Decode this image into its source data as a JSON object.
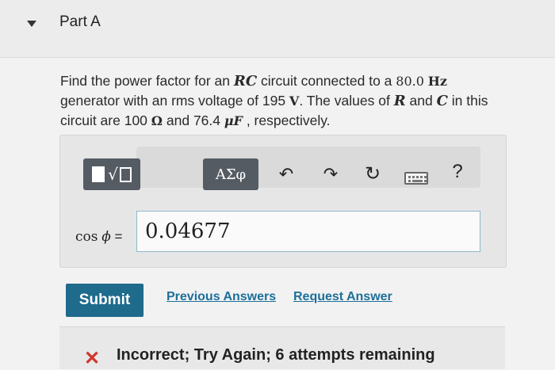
{
  "part": {
    "title": "Part A"
  },
  "question": {
    "text1": "Find the power factor for an ",
    "rc": "RC",
    "text2": " circuit connected to a ",
    "freq_value": "80.0",
    "freq_unit": "Hz",
    "text3": "generator with an rms voltage of 195 ",
    "volt_unit": "V",
    "text4": ". The values of ",
    "r": "R",
    "text5": " and ",
    "c": "C",
    "text6": " in this",
    "text7": "circuit are 100 ",
    "ohm_unit": "Ω",
    "text8": " and 76.4 ",
    "cap_unit": "μF",
    "text9": " , respectively."
  },
  "toolbar": {
    "symbols_label": "ΑΣφ",
    "templates_icon": "radical-template-icon",
    "undo_icon": "undo-arrow-icon",
    "redo_icon": "redo-arrow-icon",
    "reset_icon": "reset-icon",
    "keyboard_icon": "keyboard-icon",
    "help_label": "?"
  },
  "equation": {
    "cos": "cos",
    "phi": "ϕ",
    "equals": " =",
    "answer_value": "0.04677"
  },
  "actions": {
    "submit_label": "Submit",
    "previous_answers_label": "Previous Answers",
    "request_answer_label": "Request Answer"
  },
  "feedback": {
    "icon": "x-icon",
    "text": "Incorrect; Try Again; 6 attempts remaining",
    "icon_color": "#d0362b"
  },
  "colors": {
    "accent": "#1e6b8c",
    "link": "#1d6f99",
    "tool_button": "#555b63"
  }
}
